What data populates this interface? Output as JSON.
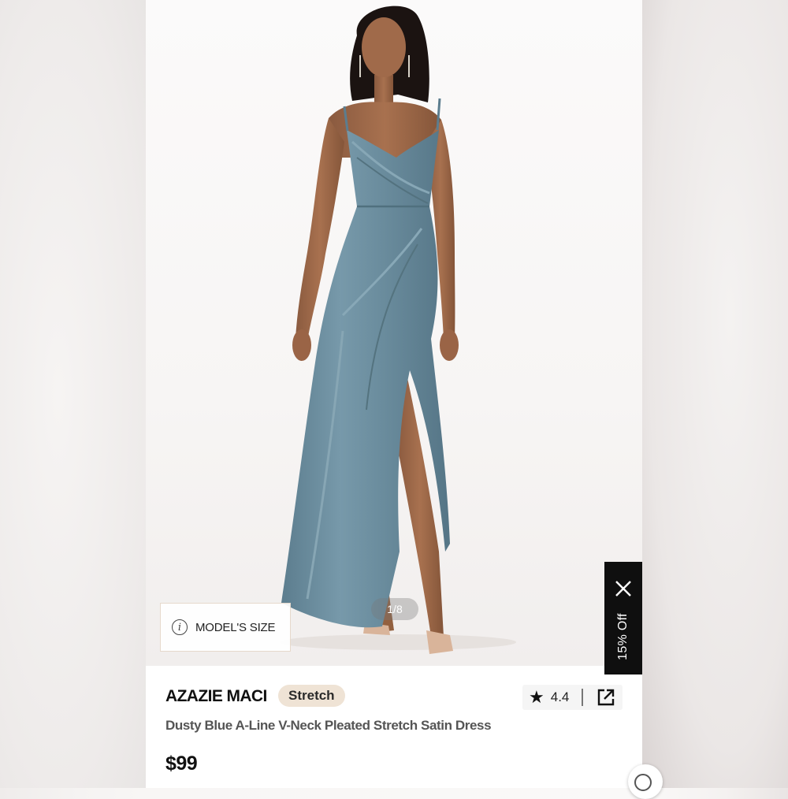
{
  "product": {
    "brand": "AZAZIE MACI",
    "tag": "Stretch",
    "name": "Dusty Blue A-Line V-Neck Pleated Stretch Satin Dress",
    "price": "$99",
    "rating": "4.4"
  },
  "gallery": {
    "pager": "1/8",
    "model_size_label": "MODEL'S SIZE",
    "info_glyph": "i"
  },
  "promo": {
    "discount_label": "15% Off"
  },
  "icons": {
    "star": "★",
    "share": "external-link-icon",
    "close": "close-icon",
    "chat": "chat-icon"
  },
  "colors": {
    "dress": "#6d8fa0",
    "tag_bg": "#efe3d5",
    "promo_bg": "#0f0f0f"
  }
}
